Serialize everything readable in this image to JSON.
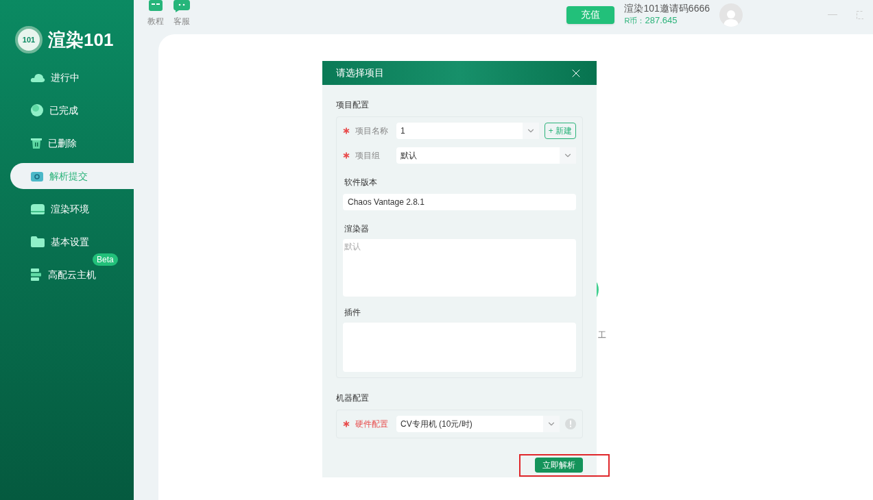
{
  "app": {
    "logo_badge": "101",
    "logo_text": "渲染101"
  },
  "sidebar": {
    "items": [
      {
        "label": "进行中",
        "kind": "cloud",
        "selected": false
      },
      {
        "label": "已完成",
        "kind": "circle",
        "selected": false
      },
      {
        "label": "已删除",
        "kind": "trash",
        "selected": false
      },
      {
        "label": "解析提交",
        "kind": "camera",
        "selected": true
      },
      {
        "label": "渲染环境",
        "kind": "card",
        "selected": false
      },
      {
        "label": "基本设置",
        "kind": "folder",
        "selected": false
      },
      {
        "label": "高配云主机",
        "kind": "server",
        "selected": false,
        "badge": "Beta"
      }
    ]
  },
  "toolbar": {
    "items": [
      {
        "label": "教程",
        "kind": "book"
      },
      {
        "label": "客服",
        "kind": "chat"
      }
    ]
  },
  "header": {
    "recharge_button": "充值",
    "invite_text": "渲染101邀请码6666",
    "balance_label": "R币：",
    "balance_value": "287.645"
  },
  "background": {
    "partial_text": "工"
  },
  "dialog": {
    "title": "请选择项目",
    "project_section": {
      "title": "项目配置",
      "project_name": {
        "label": "项目名称",
        "required": true,
        "value": "1",
        "new_button": "+ 新建"
      },
      "project_group": {
        "label": "项目组",
        "required": true,
        "value": "默认"
      },
      "software_version": {
        "label": "软件版本",
        "value": "Chaos Vantage 2.8.1"
      },
      "renderer": {
        "label": "渲染器",
        "placeholder": "默认"
      },
      "plugins": {
        "label": "插件"
      }
    },
    "machine_section": {
      "title": "机器配置",
      "hardware": {
        "label": "硬件配置",
        "required": true,
        "invalid": true,
        "value": "CV专用机 (10元/时)"
      }
    },
    "submit_button": {
      "label": "立即解析",
      "highlighted": true
    }
  }
}
